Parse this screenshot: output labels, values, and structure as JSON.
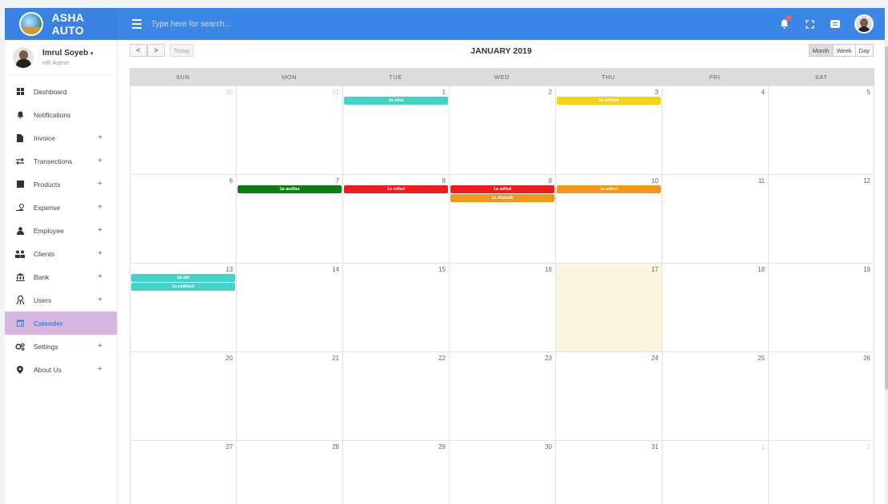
{
  "app": {
    "name": "ASHA AUTO"
  },
  "search": {
    "placeholder": "Type here for search..."
  },
  "user": {
    "name": "Imrul Soyeb",
    "role": "HR Admin"
  },
  "sidebar": {
    "items": [
      {
        "label": "Dashboard",
        "icon": "dashboard-icon",
        "has_submenu": false
      },
      {
        "label": "Notifications",
        "icon": "bell-icon",
        "has_submenu": false
      },
      {
        "label": "Invoice",
        "icon": "file-icon",
        "has_submenu": true
      },
      {
        "label": "Transections",
        "icon": "exchange-icon",
        "has_submenu": true
      },
      {
        "label": "Products",
        "icon": "box-icon",
        "has_submenu": true
      },
      {
        "label": "Expense",
        "icon": "hand-coin-icon",
        "has_submenu": true
      },
      {
        "label": "Employee",
        "icon": "user-tie-icon",
        "has_submenu": true
      },
      {
        "label": "Clients",
        "icon": "users-icon",
        "has_submenu": true
      },
      {
        "label": "Bank",
        "icon": "bank-icon",
        "has_submenu": true
      },
      {
        "label": "Users",
        "icon": "user-group-icon",
        "has_submenu": true
      },
      {
        "label": "Calender",
        "icon": "calendar-icon",
        "has_submenu": false,
        "active": true
      },
      {
        "label": "Settings",
        "icon": "cogs-icon",
        "has_submenu": true
      },
      {
        "label": "About Us",
        "icon": "map-marker-icon",
        "has_submenu": true
      }
    ],
    "plus_symbol": "+"
  },
  "calendar": {
    "title": "JANUARY 2019",
    "nav": {
      "prev": "<",
      "next": ">",
      "today": "Today"
    },
    "views": [
      "Month",
      "Week",
      "Day"
    ],
    "active_view": "Month",
    "weekdays": [
      "SUN",
      "MON",
      "TUE",
      "WED",
      "THU",
      "FRI",
      "SAT"
    ],
    "weeks": [
      [
        {
          "n": "30",
          "other": true
        },
        {
          "n": "31",
          "other": true
        },
        {
          "n": "1"
        },
        {
          "n": "2"
        },
        {
          "n": "3"
        },
        {
          "n": "4"
        },
        {
          "n": "5"
        }
      ],
      [
        {
          "n": "6"
        },
        {
          "n": "7"
        },
        {
          "n": "8"
        },
        {
          "n": "9"
        },
        {
          "n": "10"
        },
        {
          "n": "11"
        },
        {
          "n": "12"
        }
      ],
      [
        {
          "n": "13"
        },
        {
          "n": "14"
        },
        {
          "n": "15"
        },
        {
          "n": "16"
        },
        {
          "n": "17",
          "today": true
        },
        {
          "n": "18"
        },
        {
          "n": "19"
        }
      ],
      [
        {
          "n": "20"
        },
        {
          "n": "21"
        },
        {
          "n": "22"
        },
        {
          "n": "23"
        },
        {
          "n": "24"
        },
        {
          "n": "25"
        },
        {
          "n": "26"
        }
      ],
      [
        {
          "n": "27"
        },
        {
          "n": "28"
        },
        {
          "n": "29"
        },
        {
          "n": "30"
        },
        {
          "n": "31"
        },
        {
          "n": "1",
          "other": true
        },
        {
          "n": "2",
          "other": true
        }
      ]
    ],
    "events": [
      {
        "week": 0,
        "day": 2,
        "slot": 0,
        "label": "1a efsd",
        "color": "#45d3c8"
      },
      {
        "week": 0,
        "day": 4,
        "slot": 0,
        "label": "1a adfasd",
        "color": "#f5d312"
      },
      {
        "week": 1,
        "day": 1,
        "slot": 0,
        "label": "1a asdfas",
        "color": "#0f7d13"
      },
      {
        "week": 1,
        "day": 2,
        "slot": 0,
        "label": "1a sdfad",
        "color": "#ee1c1c"
      },
      {
        "week": 1,
        "day": 3,
        "slot": 0,
        "label": "1a adfsd",
        "color": "#ee1c1c"
      },
      {
        "week": 1,
        "day": 3,
        "slot": 1,
        "label": "1a Akdsdk",
        "color": "#f49719"
      },
      {
        "week": 1,
        "day": 4,
        "slot": 0,
        "label": "1a adfsd",
        "color": "#f49719"
      },
      {
        "week": 2,
        "day": 0,
        "slot": 0,
        "label": "1a afs",
        "color": "#45d3c8"
      },
      {
        "week": 2,
        "day": 0,
        "slot": 1,
        "label": "1a asdfasd",
        "color": "#45d3c8"
      }
    ]
  },
  "colors": {
    "topbar": "#3b86e6",
    "active_nav": "#d6b7e0",
    "today_bg": "#fcf5df"
  }
}
